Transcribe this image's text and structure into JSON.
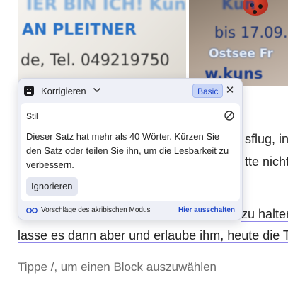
{
  "background_photo_left": {
    "lines": [
      "IER BIN ICH! Kunst",
      "AN PLEITNER",
      "de, Tel. 049219750"
    ]
  },
  "background_photo_right": {
    "lines": [
      "Kun",
      "bis 17.09.",
      "Ostsee Fr",
      "w.kuns"
    ]
  },
  "editor": {
    "lines": [
      "sflug, in",
      "tte nicht",
      "zu halter",
      "lasse es dann aber und erlaube ihm, heute die Ti"
    ],
    "placeholder": "Tippe /, um einen Block auszuwählen"
  },
  "popup": {
    "header": {
      "title": "Korrigieren",
      "badge": "Basic",
      "close_symbol": "✕"
    },
    "card": {
      "title": "Stil",
      "message": "Dieser Satz hat mehr als 40 Wörter. Kürzen Sie den Satz oder teilen Sie ihn, um die Lesbarkeit zu verbessern.",
      "ignore_label": "Ignorieren"
    },
    "footer": {
      "mode_text": "Vorschläge des akribischen Modus",
      "link_text": "Hier ausschalten"
    }
  },
  "colors": {
    "accent": "#1f47c8",
    "underline": "#8f86e8",
    "popup_bg": "#eef0f7"
  },
  "icons": [
    "logo-icon",
    "chevron-down-icon",
    "close-icon",
    "ban-icon",
    "glasses-icon"
  ]
}
